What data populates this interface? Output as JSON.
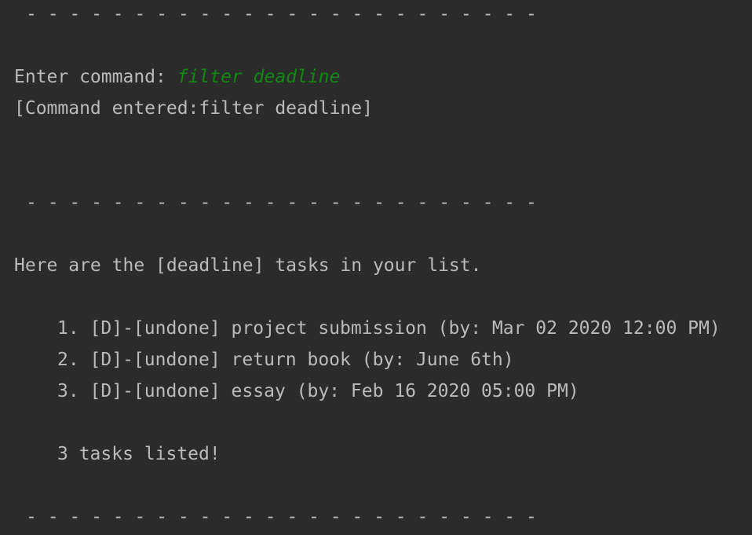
{
  "console": {
    "separator": "- - - - - - - - - - - - - - - - - - - - - - - -",
    "prompt_label": "Enter command: ",
    "user_input": "filter deadline",
    "command_echo": "[Command entered:filter deadline]",
    "result_header": "Here are the [deadline] tasks in your list.",
    "tasks": [
      "1. [D]-[undone] project submission (by: Mar 02 2020 12:00 PM)",
      "2. [D]-[undone] return book (by: June 6th)",
      "3. [D]-[undone] essay (by: Feb 16 2020 05:00 PM)"
    ],
    "summary": "3 tasks listed!"
  },
  "colors": {
    "background": "#2b2b2b",
    "text": "#bbbbbb",
    "user_input": "#108a10"
  }
}
